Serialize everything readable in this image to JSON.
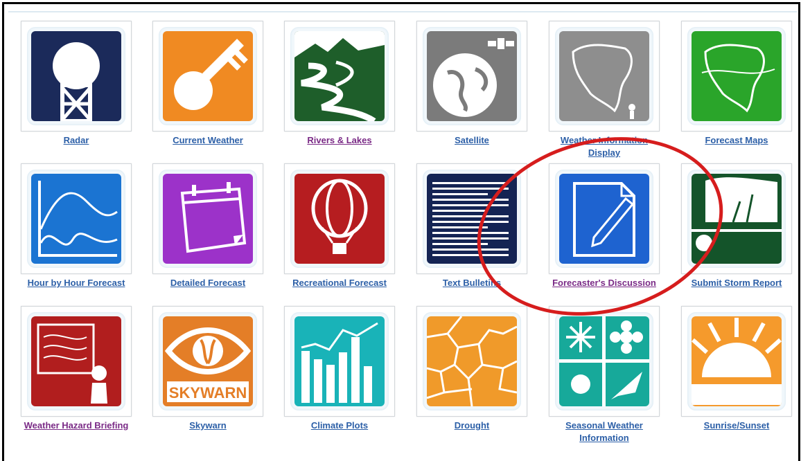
{
  "tiles": [
    {
      "label": "Radar",
      "icon": "radar-tower-icon",
      "color": "#1b2a5a",
      "visited": false
    },
    {
      "label": "Current Weather",
      "icon": "key-icon",
      "color": "#f08a22",
      "visited": false
    },
    {
      "label": "Rivers & Lakes",
      "icon": "river-icon",
      "color": "#1e5e2a",
      "visited": true
    },
    {
      "label": "Satellite",
      "icon": "globe-satellite-icon",
      "color": "#7b7b7b",
      "visited": false
    },
    {
      "label": "Weather Information Display",
      "icon": "map-display-icon",
      "color": "#8e8e8e",
      "visited": false
    },
    {
      "label": "Forecast Maps",
      "icon": "map-icon",
      "color": "#2aa52a",
      "visited": false
    },
    {
      "label": "Hour by Hour Forecast",
      "icon": "graph-icon",
      "color": "#1b74d2",
      "visited": false
    },
    {
      "label": "Detailed Forecast",
      "icon": "calendar-icon",
      "color": "#9c32c9",
      "visited": false
    },
    {
      "label": "Recreational Forecast",
      "icon": "hot-air-balloon-icon",
      "color": "#b61d20",
      "visited": false
    },
    {
      "label": "Text Bulletins",
      "icon": "text-document-icon",
      "color": "#142454",
      "visited": false
    },
    {
      "label": "Forecaster's Discussion",
      "icon": "pencil-paper-icon",
      "color": "#1e63d0",
      "visited": true
    },
    {
      "label": "Submit Storm Report",
      "icon": "storm-report-icon",
      "color": "#14542a",
      "visited": false
    },
    {
      "label": "Weather Hazard Briefing",
      "icon": "briefing-icon",
      "color": "#b11e1e",
      "visited": true
    },
    {
      "label": "Skywarn",
      "icon": "skywarn-eye-icon",
      "color": "#e47e27",
      "visited": false
    },
    {
      "label": "Climate Plots",
      "icon": "bar-chart-icon",
      "color": "#19b3b8",
      "visited": false
    },
    {
      "label": "Drought",
      "icon": "cracked-ground-icon",
      "color": "#f09a2a",
      "visited": false
    },
    {
      "label": "Seasonal Weather Information",
      "icon": "seasons-icon",
      "color": "#17a99a",
      "visited": false
    },
    {
      "label": "Sunrise/Sunset",
      "icon": "sunrise-icon",
      "color": "#f59a2c",
      "visited": false
    }
  ],
  "skywarn_text": "SKYWARN",
  "highlight_color": "#d61d1d"
}
